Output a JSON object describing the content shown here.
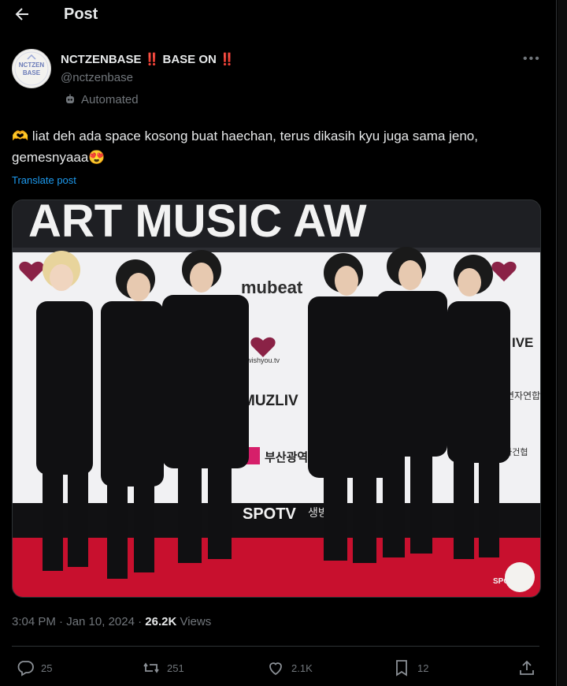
{
  "header": {
    "title": "Post",
    "back_icon": "arrow-left-icon"
  },
  "author": {
    "name": "NCTZENBASE ‼️ BASE ON ‼️",
    "handle": "@nctzenbase",
    "automated_label": "Automated",
    "avatar_text": [
      "NCTZEN",
      "BASE"
    ]
  },
  "post": {
    "text": "🫶 liat deh ada space kosong buat haechan, terus dikasih kyu juga sama jeno, gemesnyaaa😍",
    "translate_label": "Translate post"
  },
  "media": {
    "banner_text": "ART MUSIC AW",
    "logos": [
      "mubeat",
      "wishyou.tv",
      "MUZLIV",
      "부산광역시",
      "SPOTV",
      "생방",
      "IVE",
      "연자연합",
      "회사건협",
      "SPO"
    ]
  },
  "meta": {
    "time": "3:04 PM · Jan 10, 2024",
    "dot": " · ",
    "views_count": "26.2K",
    "views_label": "Views"
  },
  "actions": {
    "reply_count": "25",
    "repost_count": "251",
    "like_count": "2.1K",
    "bookmark_count": "12"
  },
  "colors": {
    "background": "#000000",
    "text": "#e7e9ea",
    "muted": "#71767b",
    "link": "#1d9bf0",
    "carpet": "#c8102e"
  }
}
